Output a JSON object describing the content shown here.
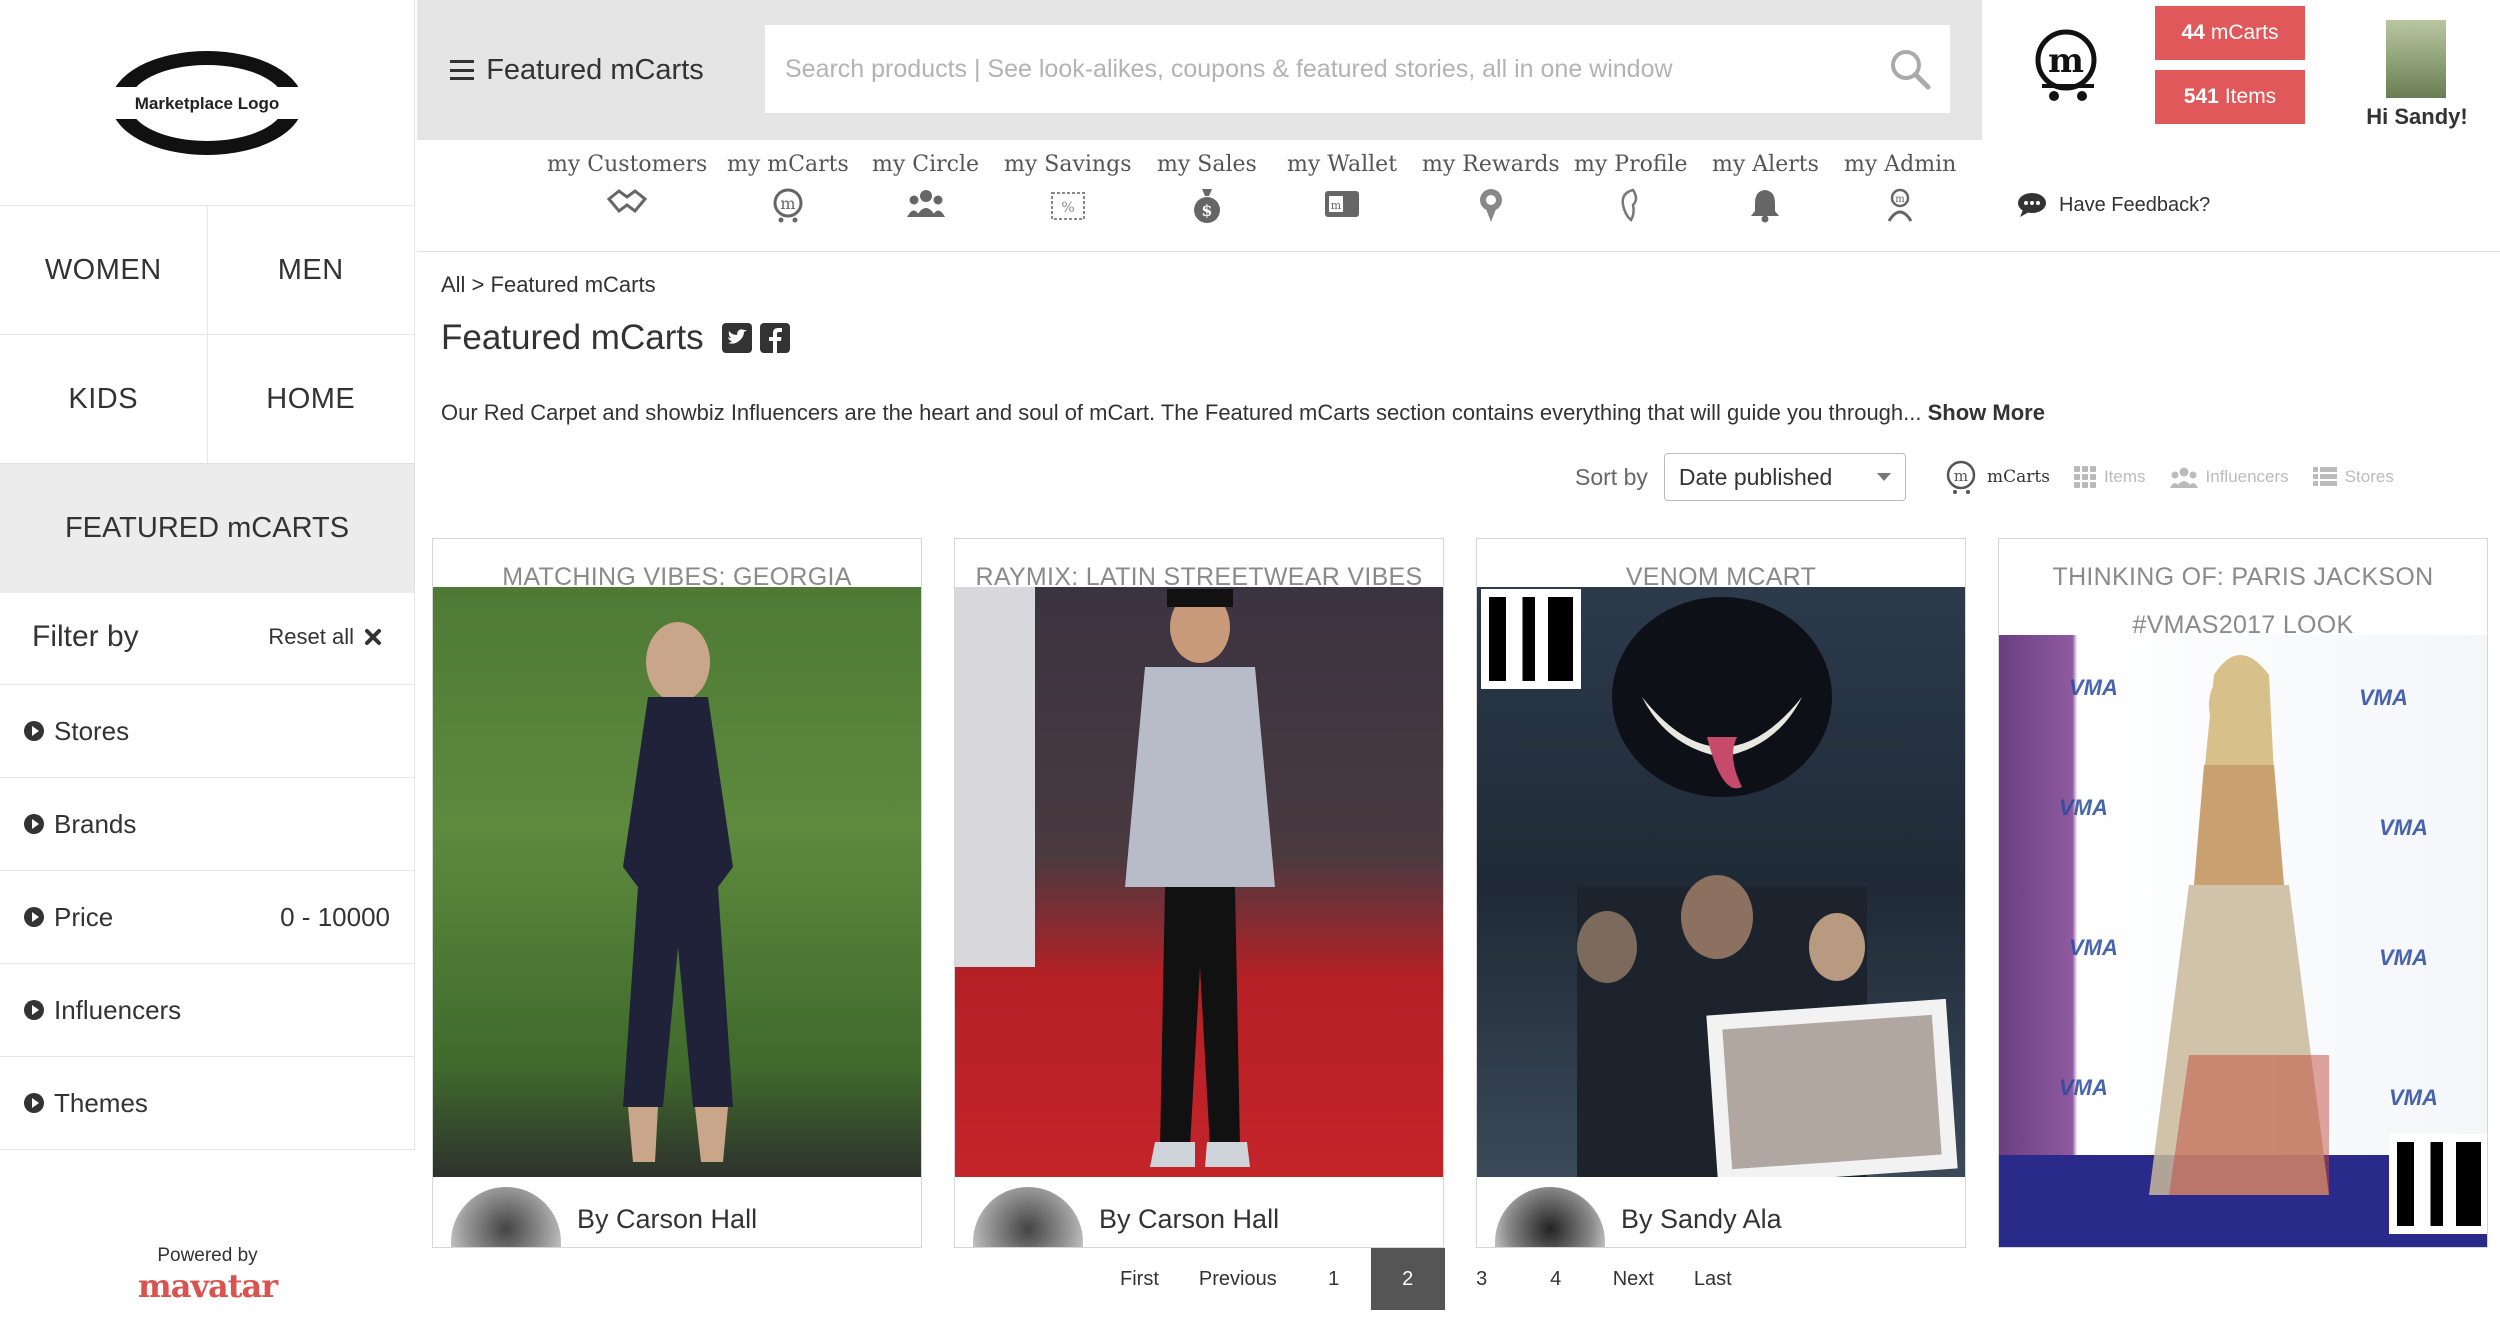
{
  "logo": {
    "text": "Marketplace Logo"
  },
  "categories": [
    "WOMEN",
    "MEN",
    "KIDS",
    "HOME"
  ],
  "featured_category": "FEATURED mCARTS",
  "filter": {
    "title": "Filter by",
    "reset_label": "Reset all",
    "items": [
      {
        "label": "Stores",
        "value": ""
      },
      {
        "label": "Brands",
        "value": ""
      },
      {
        "label": "Price",
        "value": "0 - 10000"
      },
      {
        "label": "Influencers",
        "value": ""
      },
      {
        "label": "Themes",
        "value": ""
      }
    ]
  },
  "powered": {
    "label": "Powered by",
    "brand": "mavatar"
  },
  "header": {
    "menu_label": "Featured mCarts",
    "search_placeholder": "Search products | See look-alikes, coupons & featured stories, all in one window",
    "mcarts_count": "44",
    "mcarts_label": "mCarts",
    "items_count": "541",
    "items_label": "Items",
    "greeting": "Hi Sandy!"
  },
  "nav": [
    {
      "label": "my Customers",
      "icon": "handshake-icon"
    },
    {
      "label": "my mCarts",
      "icon": "mcart-icon"
    },
    {
      "label": "my Circle",
      "icon": "people-icon"
    },
    {
      "label": "my Savings",
      "icon": "coupon-icon"
    },
    {
      "label": "my Sales",
      "icon": "money-bag-icon"
    },
    {
      "label": "my Wallet",
      "icon": "wallet-icon"
    },
    {
      "label": "my Rewards",
      "icon": "medal-icon"
    },
    {
      "label": "my Profile",
      "icon": "profile-icon"
    },
    {
      "label": "my Alerts",
      "icon": "bell-icon"
    },
    {
      "label": "my Admin",
      "icon": "admin-icon"
    }
  ],
  "feedback_label": "Have Feedback?",
  "main": {
    "breadcrumb": "All > Featured mCarts",
    "title": "Featured mCarts",
    "description": "Our Red Carpet and showbiz Influencers are the heart and soul of mCart. The Featured mCarts section contains everything that will guide you through...",
    "show_more": "Show More",
    "sort_label": "Sort by",
    "sort_value": "Date published",
    "view_tabs": [
      "mCarts",
      "Items",
      "Influencers",
      "Stores"
    ],
    "active_view": "mCarts"
  },
  "cards": [
    {
      "title": "MATCHING VIBES: GEORGIA FOWLER",
      "author": "By Carson Hall"
    },
    {
      "title": "RAYMIX: LATIN STREETWEAR VIBES",
      "author": "By Carson Hall"
    },
    {
      "title": "VENOM MCART",
      "author": "By Sandy Ala"
    },
    {
      "title": "THINKING OF: PARIS JACKSON #VMAS2017 LOOK",
      "author": ""
    }
  ],
  "pagination": [
    "First",
    "Previous",
    "1",
    "2",
    "3",
    "4",
    "Next",
    "Last"
  ],
  "current_page": "2",
  "colors": {
    "accent": "#e0585a",
    "active_page": "#555555"
  }
}
